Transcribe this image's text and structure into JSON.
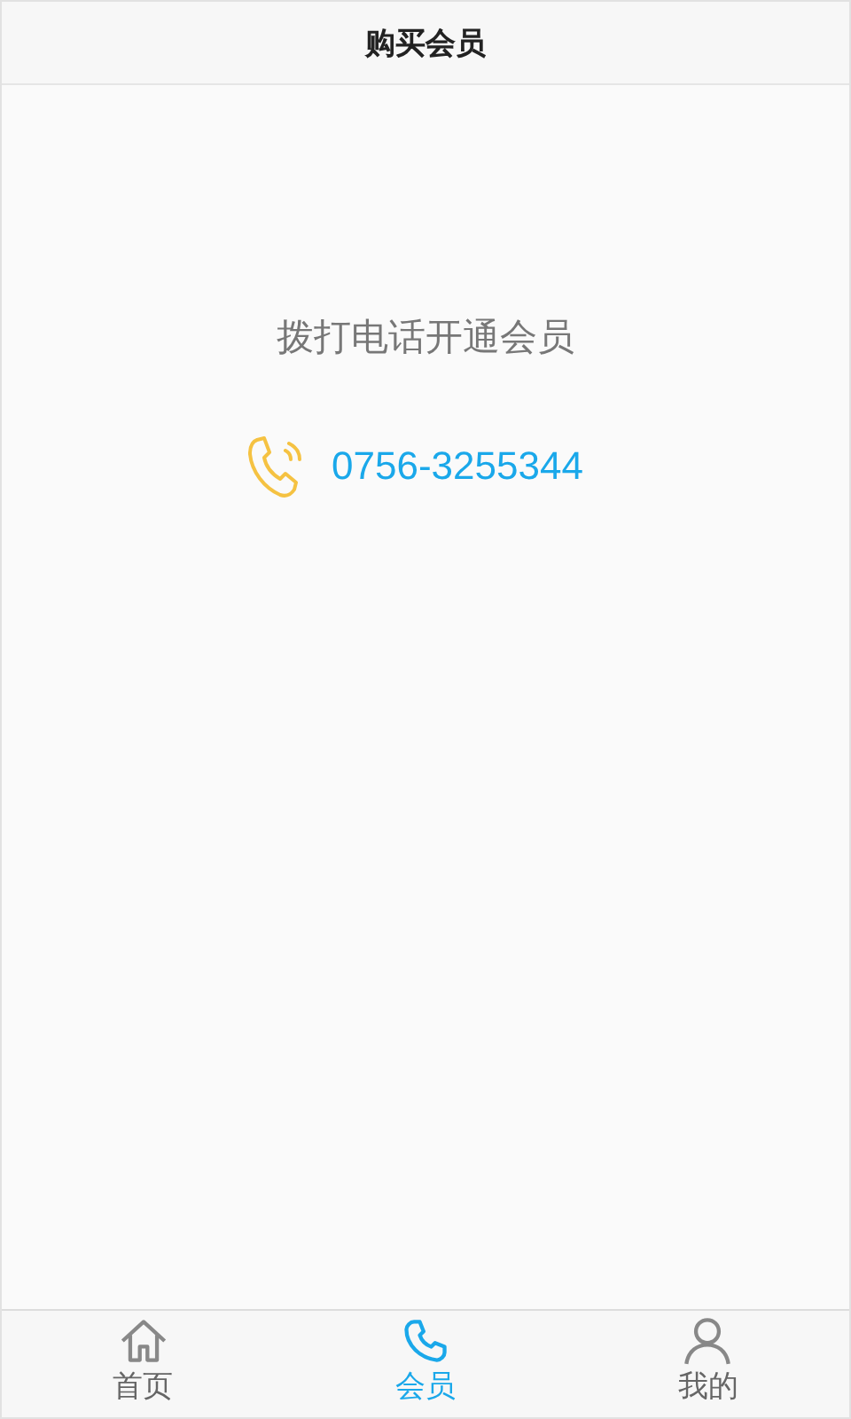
{
  "header": {
    "title": "购买会员"
  },
  "content": {
    "heading": "拨打电话开通会员",
    "phone": "0756-3255344"
  },
  "tabs": [
    {
      "kind": "home",
      "label": "首页",
      "selected": false
    },
    {
      "kind": "phone",
      "label": "会员",
      "selected": true
    },
    {
      "kind": "user",
      "label": "我的",
      "selected": false
    }
  ]
}
